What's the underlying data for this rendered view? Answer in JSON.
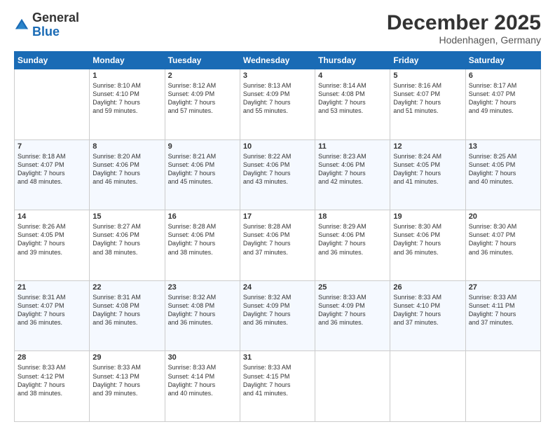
{
  "header": {
    "logo_line1": "General",
    "logo_line2": "Blue",
    "month": "December 2025",
    "location": "Hodenhagen, Germany"
  },
  "days_of_week": [
    "Sunday",
    "Monday",
    "Tuesday",
    "Wednesday",
    "Thursday",
    "Friday",
    "Saturday"
  ],
  "weeks": [
    [
      {
        "num": "",
        "info": ""
      },
      {
        "num": "1",
        "info": "Sunrise: 8:10 AM\nSunset: 4:10 PM\nDaylight: 7 hours\nand 59 minutes."
      },
      {
        "num": "2",
        "info": "Sunrise: 8:12 AM\nSunset: 4:09 PM\nDaylight: 7 hours\nand 57 minutes."
      },
      {
        "num": "3",
        "info": "Sunrise: 8:13 AM\nSunset: 4:09 PM\nDaylight: 7 hours\nand 55 minutes."
      },
      {
        "num": "4",
        "info": "Sunrise: 8:14 AM\nSunset: 4:08 PM\nDaylight: 7 hours\nand 53 minutes."
      },
      {
        "num": "5",
        "info": "Sunrise: 8:16 AM\nSunset: 4:07 PM\nDaylight: 7 hours\nand 51 minutes."
      },
      {
        "num": "6",
        "info": "Sunrise: 8:17 AM\nSunset: 4:07 PM\nDaylight: 7 hours\nand 49 minutes."
      }
    ],
    [
      {
        "num": "7",
        "info": "Sunrise: 8:18 AM\nSunset: 4:07 PM\nDaylight: 7 hours\nand 48 minutes."
      },
      {
        "num": "8",
        "info": "Sunrise: 8:20 AM\nSunset: 4:06 PM\nDaylight: 7 hours\nand 46 minutes."
      },
      {
        "num": "9",
        "info": "Sunrise: 8:21 AM\nSunset: 4:06 PM\nDaylight: 7 hours\nand 45 minutes."
      },
      {
        "num": "10",
        "info": "Sunrise: 8:22 AM\nSunset: 4:06 PM\nDaylight: 7 hours\nand 43 minutes."
      },
      {
        "num": "11",
        "info": "Sunrise: 8:23 AM\nSunset: 4:06 PM\nDaylight: 7 hours\nand 42 minutes."
      },
      {
        "num": "12",
        "info": "Sunrise: 8:24 AM\nSunset: 4:05 PM\nDaylight: 7 hours\nand 41 minutes."
      },
      {
        "num": "13",
        "info": "Sunrise: 8:25 AM\nSunset: 4:05 PM\nDaylight: 7 hours\nand 40 minutes."
      }
    ],
    [
      {
        "num": "14",
        "info": "Sunrise: 8:26 AM\nSunset: 4:05 PM\nDaylight: 7 hours\nand 39 minutes."
      },
      {
        "num": "15",
        "info": "Sunrise: 8:27 AM\nSunset: 4:06 PM\nDaylight: 7 hours\nand 38 minutes."
      },
      {
        "num": "16",
        "info": "Sunrise: 8:28 AM\nSunset: 4:06 PM\nDaylight: 7 hours\nand 38 minutes."
      },
      {
        "num": "17",
        "info": "Sunrise: 8:28 AM\nSunset: 4:06 PM\nDaylight: 7 hours\nand 37 minutes."
      },
      {
        "num": "18",
        "info": "Sunrise: 8:29 AM\nSunset: 4:06 PM\nDaylight: 7 hours\nand 36 minutes."
      },
      {
        "num": "19",
        "info": "Sunrise: 8:30 AM\nSunset: 4:06 PM\nDaylight: 7 hours\nand 36 minutes."
      },
      {
        "num": "20",
        "info": "Sunrise: 8:30 AM\nSunset: 4:07 PM\nDaylight: 7 hours\nand 36 minutes."
      }
    ],
    [
      {
        "num": "21",
        "info": "Sunrise: 8:31 AM\nSunset: 4:07 PM\nDaylight: 7 hours\nand 36 minutes."
      },
      {
        "num": "22",
        "info": "Sunrise: 8:31 AM\nSunset: 4:08 PM\nDaylight: 7 hours\nand 36 minutes."
      },
      {
        "num": "23",
        "info": "Sunrise: 8:32 AM\nSunset: 4:08 PM\nDaylight: 7 hours\nand 36 minutes."
      },
      {
        "num": "24",
        "info": "Sunrise: 8:32 AM\nSunset: 4:09 PM\nDaylight: 7 hours\nand 36 minutes."
      },
      {
        "num": "25",
        "info": "Sunrise: 8:33 AM\nSunset: 4:09 PM\nDaylight: 7 hours\nand 36 minutes."
      },
      {
        "num": "26",
        "info": "Sunrise: 8:33 AM\nSunset: 4:10 PM\nDaylight: 7 hours\nand 37 minutes."
      },
      {
        "num": "27",
        "info": "Sunrise: 8:33 AM\nSunset: 4:11 PM\nDaylight: 7 hours\nand 37 minutes."
      }
    ],
    [
      {
        "num": "28",
        "info": "Sunrise: 8:33 AM\nSunset: 4:12 PM\nDaylight: 7 hours\nand 38 minutes."
      },
      {
        "num": "29",
        "info": "Sunrise: 8:33 AM\nSunset: 4:13 PM\nDaylight: 7 hours\nand 39 minutes."
      },
      {
        "num": "30",
        "info": "Sunrise: 8:33 AM\nSunset: 4:14 PM\nDaylight: 7 hours\nand 40 minutes."
      },
      {
        "num": "31",
        "info": "Sunrise: 8:33 AM\nSunset: 4:15 PM\nDaylight: 7 hours\nand 41 minutes."
      },
      {
        "num": "",
        "info": ""
      },
      {
        "num": "",
        "info": ""
      },
      {
        "num": "",
        "info": ""
      }
    ]
  ]
}
